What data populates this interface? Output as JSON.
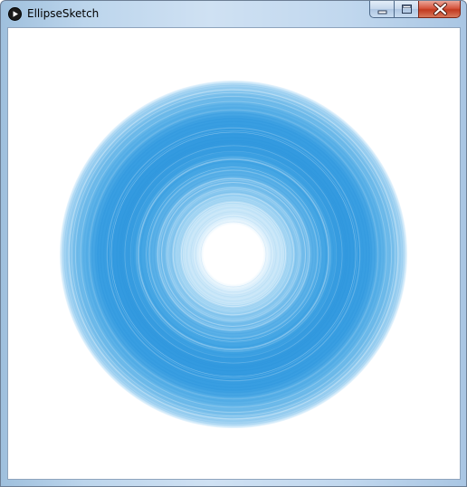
{
  "window": {
    "title": "EllipseSketch",
    "app_icon": "play-icon",
    "buttons": {
      "minimize_icon": "minimize-icon",
      "maximize_icon": "maximize-icon",
      "close_icon": "close-icon"
    }
  },
  "sketch": {
    "background_color": "#ffffff",
    "ring_color": "#2f9be0",
    "ring_light_color": "#8ccaf0",
    "center_color": "#ffffff"
  }
}
